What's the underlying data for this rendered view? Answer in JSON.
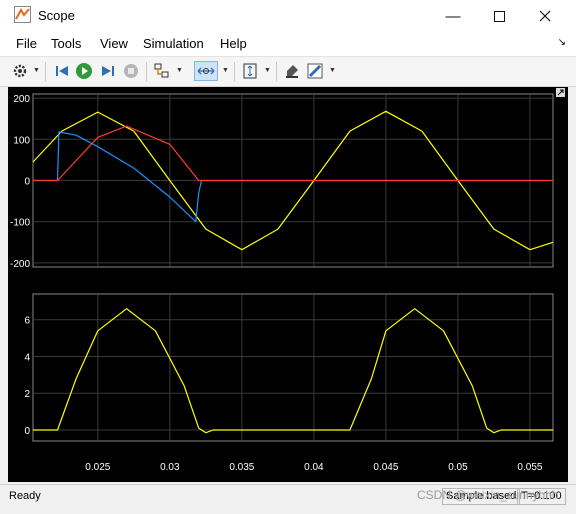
{
  "window": {
    "title": "Scope"
  },
  "menu": {
    "items": [
      "File",
      "Tools",
      "View",
      "Simulation",
      "Help"
    ]
  },
  "toolbar": {
    "buttons": [
      "settings-icon",
      "step-back-icon",
      "run-icon",
      "step-forward-icon",
      "stop-icon",
      "signal-select-icon",
      "zoom-icon",
      "autoscale-icon",
      "highlight-icon",
      "style-icon"
    ]
  },
  "colors": {
    "yellow": "#ffff00",
    "blue": "#1e90ff",
    "red": "#ff3b30",
    "grid": "#3a3a3a",
    "axis_text": "#ffffff"
  },
  "chart_data": [
    {
      "type": "line",
      "title": "",
      "xlabel": "",
      "ylabel": "",
      "xlim": [
        0.0205,
        0.0566
      ],
      "ylim": [
        -210,
        210
      ],
      "yticks": [
        -200,
        -100,
        0,
        100,
        200
      ],
      "ytick_labels": [
        "-200",
        "-100",
        "0",
        "100",
        "200"
      ],
      "grid": true,
      "series": [
        {
          "color": "#ffff00",
          "x": [
            0.0205,
            0.0225,
            0.025,
            0.0275,
            0.03,
            0.0325,
            0.035,
            0.0375,
            0.04,
            0.0425,
            0.045,
            0.0475,
            0.05,
            0.0525,
            0.055,
            0.0566
          ],
          "y": [
            45,
            120,
            166,
            120,
            0,
            -118,
            -168,
            -118,
            0,
            120,
            168,
            120,
            0,
            -118,
            -168,
            -150
          ]
        },
        {
          "color": "#1e90ff",
          "x": [
            0.0205,
            0.0222,
            0.0223,
            0.0235,
            0.025,
            0.0275,
            0.03,
            0.0318,
            0.032,
            0.0322,
            0.0325,
            0.056
          ],
          "y": [
            0,
            0,
            118,
            110,
            82,
            30,
            -40,
            -100,
            -30,
            0,
            0,
            0
          ]
        },
        {
          "color": "#ff3b30",
          "x": [
            0.0205,
            0.0222,
            0.025,
            0.027,
            0.03,
            0.032,
            0.0322,
            0.0566
          ],
          "y": [
            0,
            0,
            105,
            132,
            88,
            0,
            0,
            0
          ]
        }
      ]
    },
    {
      "type": "line",
      "title": "",
      "xlabel": "",
      "ylabel": "",
      "xlim": [
        0.0205,
        0.0566
      ],
      "ylim": [
        -0.6,
        7.4
      ],
      "yticks": [
        0,
        2,
        4,
        6
      ],
      "ytick_labels": [
        "0",
        "2",
        "4",
        "6"
      ],
      "xticks": [
        0.025,
        0.03,
        0.035,
        0.04,
        0.045,
        0.05,
        0.055
      ],
      "xtick_labels": [
        "0.025",
        "0.03",
        "0.035",
        "0.04",
        "0.045",
        "0.05",
        "0.055"
      ],
      "grid": true,
      "series": [
        {
          "color": "#ffff00",
          "x": [
            0.0205,
            0.0222,
            0.0235,
            0.025,
            0.027,
            0.029,
            0.031,
            0.032,
            0.0325,
            0.033,
            0.0425,
            0.044,
            0.045,
            0.047,
            0.049,
            0.051,
            0.052,
            0.0525,
            0.053,
            0.0566
          ],
          "y": [
            0,
            0,
            2.8,
            5.4,
            6.6,
            5.4,
            2.4,
            0.1,
            -0.15,
            0,
            0,
            2.8,
            5.4,
            6.6,
            5.4,
            2.4,
            0.1,
            -0.15,
            0,
            0
          ]
        }
      ]
    }
  ],
  "status": {
    "ready": "Ready",
    "mode": "Sample based",
    "time": "T=0.100"
  },
  "watermark": "CSDN @weixin_sunnyhhh"
}
